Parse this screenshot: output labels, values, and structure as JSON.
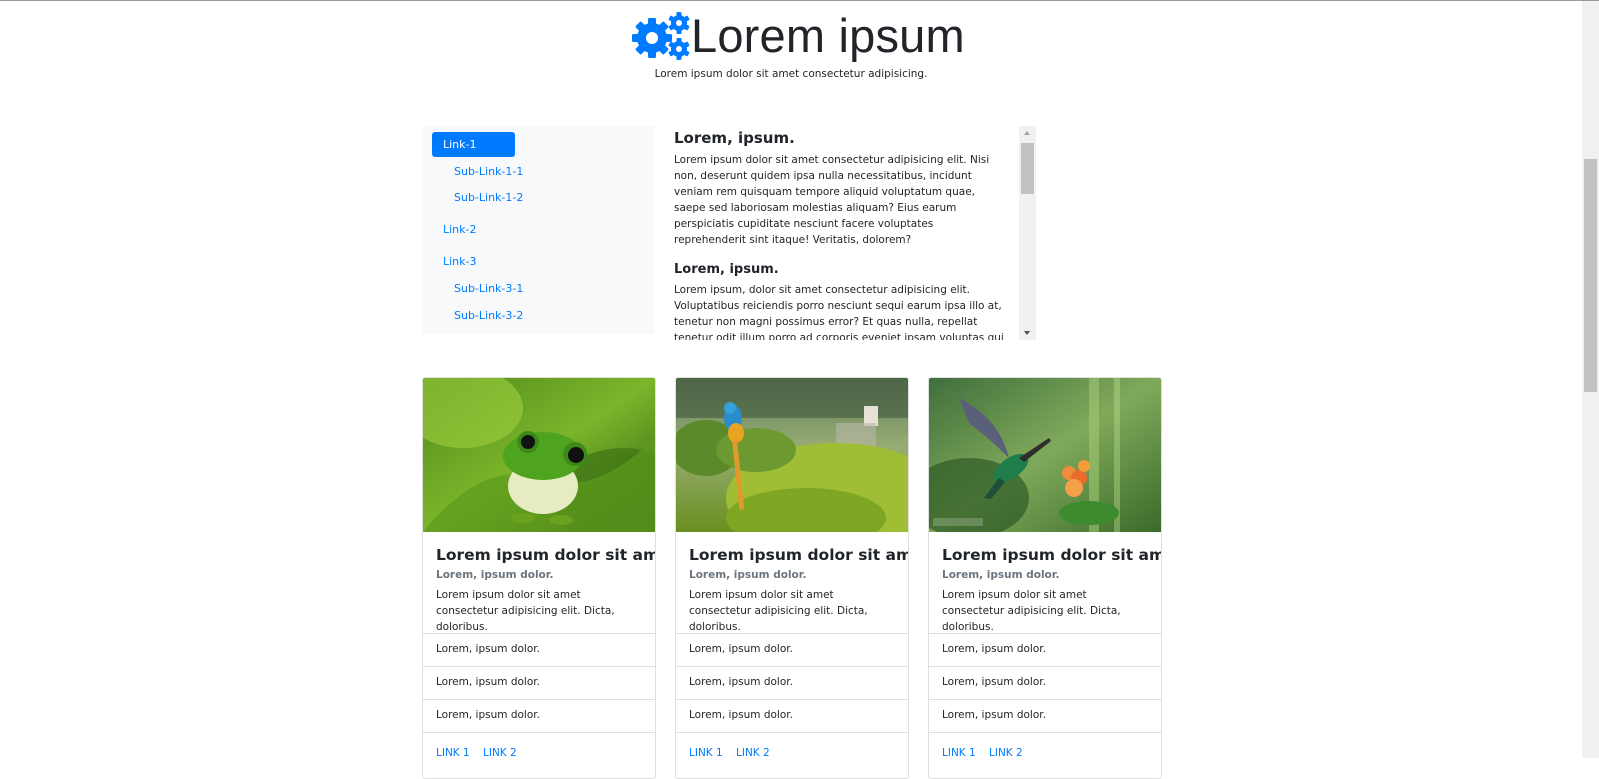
{
  "header": {
    "title": "Lorem ipsum",
    "subtitle": "Lorem ipsum dolor sit amet consectetur adipisicing."
  },
  "nav": {
    "items": [
      {
        "label": "Link-1",
        "active": true
      },
      {
        "label": "Sub-Link-1-1"
      },
      {
        "label": "Sub-Link-1-2"
      },
      {
        "label": "Link-2"
      },
      {
        "label": "Link-3"
      },
      {
        "label": "Sub-Link-3-1"
      },
      {
        "label": "Sub-Link-3-2"
      }
    ]
  },
  "content": {
    "sections": [
      {
        "heading": "Lorem, ipsum.",
        "text": "Lorem ipsum dolor sit amet consectetur adipisicing elit. Nisi non, deserunt quidem ipsa nulla necessitatibus, incidunt veniam rem quisquam tempore aliquid voluptatum quae, saepe sed laboriosam molestias aliquam? Eius earum perspiciatis cupiditate nesciunt facere voluptates reprehenderit sint itaque! Veritatis, dolorem?"
      },
      {
        "heading": "Lorem, ipsum.",
        "text": "Lorem ipsum, dolor sit amet consectetur adipisicing elit. Voluptatibus reiciendis porro nesciunt sequi earum ipsa illo at, tenetur non magni possimus error? Et quas nulla, repellat tenetur odit illum porro ad corporis eveniet ipsam voluptas qui cum asperiores alias non!"
      }
    ]
  },
  "cards": [
    {
      "image": "frog-photo",
      "title": "Lorem ipsum dolor sit amet.",
      "subtitle": "Lorem, ipsum dolor.",
      "text": "Lorem ipsum dolor sit amet consectetur adipisicing elit. Dicta, doloribus.",
      "list": [
        "Lorem, ipsum dolor.",
        "Lorem, ipsum dolor.",
        "Lorem, ipsum dolor."
      ],
      "links": [
        "LINK 1",
        "LINK 2"
      ]
    },
    {
      "image": "parrot-photo",
      "title": "Lorem ipsum dolor sit amet.",
      "subtitle": "Lorem, ipsum dolor.",
      "text": "Lorem ipsum dolor sit amet consectetur adipisicing elit. Dicta, doloribus.",
      "list": [
        "Lorem, ipsum dolor.",
        "Lorem, ipsum dolor.",
        "Lorem, ipsum dolor."
      ],
      "links": [
        "LINK 1",
        "LINK 2"
      ]
    },
    {
      "image": "hummingbird-photo",
      "title": "Lorem ipsum dolor sit amet.",
      "subtitle": "Lorem, ipsum dolor.",
      "text": "Lorem ipsum dolor sit amet consectetur adipisicing elit. Dicta, doloribus.",
      "list": [
        "Lorem, ipsum dolor.",
        "Lorem, ipsum dolor.",
        "Lorem, ipsum dolor."
      ],
      "links": [
        "LINK 1",
        "LINK 2"
      ]
    }
  ],
  "colors": {
    "accent": "#007bff",
    "nav_background": "#f8f9fa",
    "muted_text": "#6c757d"
  },
  "icons": {
    "logo": "gears-icon"
  }
}
